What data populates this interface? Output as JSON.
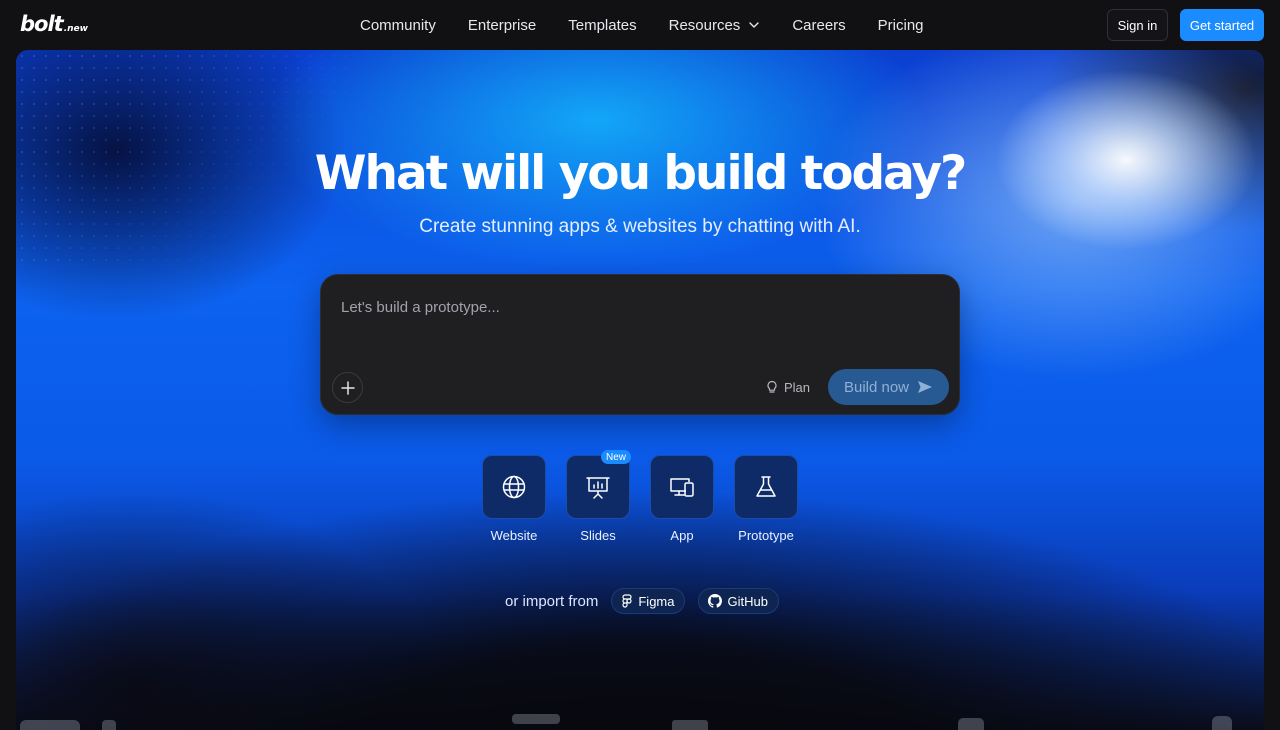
{
  "header": {
    "logo_main": "bolt",
    "logo_sub": ".new",
    "nav": [
      {
        "label": "Community"
      },
      {
        "label": "Enterprise"
      },
      {
        "label": "Templates"
      },
      {
        "label": "Resources"
      },
      {
        "label": "Careers"
      },
      {
        "label": "Pricing"
      }
    ],
    "signin_label": "Sign in",
    "get_started_label": "Get started"
  },
  "hero": {
    "title": "What will you build today?",
    "subtitle": "Create stunning apps & websites by chatting with AI."
  },
  "prompt": {
    "placeholder": "Let's build a prototype...",
    "value": "",
    "plan_label": "Plan",
    "build_label": "Build now"
  },
  "types": [
    {
      "label": "Website",
      "icon": "globe-icon"
    },
    {
      "label": "Slides",
      "icon": "presentation-icon",
      "badge": "New"
    },
    {
      "label": "App",
      "icon": "devices-icon"
    },
    {
      "label": "Prototype",
      "icon": "flask-icon"
    }
  ],
  "import": {
    "label": "or import from",
    "figma": "Figma",
    "github": "GitHub"
  },
  "colors": {
    "accent": "#1b8cff",
    "prompt_bg": "#1f1f22",
    "build_button_bg": "#275a92",
    "tile_bg": "#0e2b68"
  }
}
